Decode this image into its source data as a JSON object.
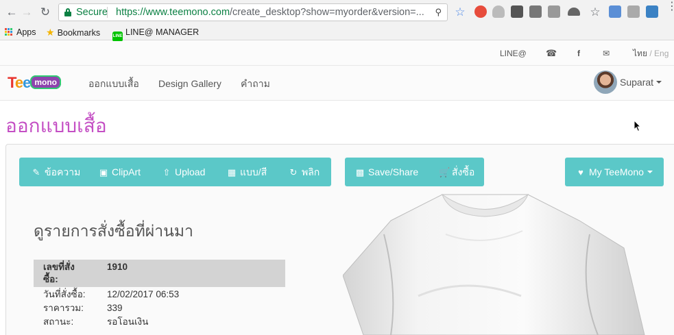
{
  "browser": {
    "secure_label": "Secure",
    "url_scheme": "https://",
    "url_host": "www.teemono.com",
    "url_path": "/create_desktop?show=myorder&version=..."
  },
  "bookmarks": {
    "items": [
      {
        "label": "Apps",
        "icon": "apps-grid-icon"
      },
      {
        "label": "Bookmarks",
        "icon": "star-icon"
      },
      {
        "label": "LINE@ MANAGER",
        "icon": "line-icon"
      }
    ]
  },
  "site_top": {
    "line_label": "LINE@",
    "lang_th": "ไทย",
    "lang_sep": "/",
    "lang_en": "Eng"
  },
  "navbar": {
    "links": [
      "ออกแบบเสื้อ",
      "Design Gallery",
      "คำถาม"
    ],
    "user_name": "Suparat"
  },
  "page_title": "ออกแบบเสื้อ",
  "toolbar": {
    "left_group": [
      "ข้อความ",
      "ClipArt",
      "Upload",
      "แบบ/สี",
      "พลิก"
    ],
    "middle_group": [
      "Save/Share",
      "สั่งซื้อ"
    ],
    "right_menu": "My TeeMono"
  },
  "order": {
    "heading": "ดูรายการสั่งซื้อที่ผ่านมา",
    "rows": [
      {
        "label_line1": "เลขที่สั่ง",
        "label_line2": "ซื้อ:",
        "value": "1910"
      },
      {
        "label": "วันที่สั่งซื้อ:",
        "value": "12/02/2017 06:53"
      },
      {
        "label": "ราคารวม:",
        "value": "339"
      },
      {
        "label": "สถานะ:",
        "value": "รอโอนเงิน"
      }
    ]
  },
  "colors": {
    "accent": "#5bc8c8",
    "title": "#c44fc4",
    "secure_green": "#0b8043"
  }
}
